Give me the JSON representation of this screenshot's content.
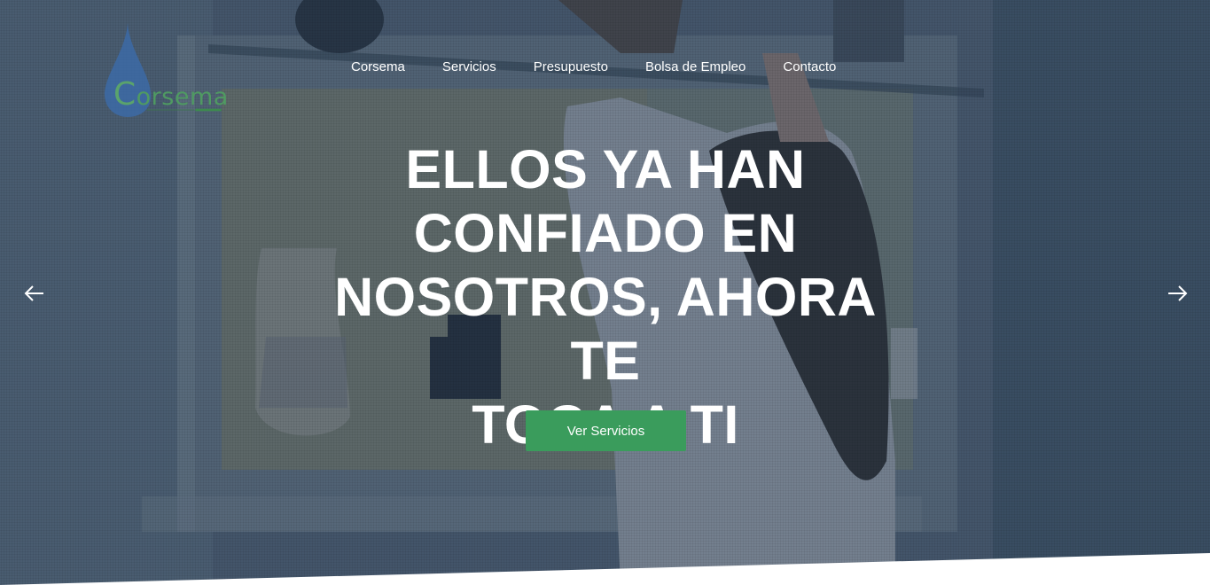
{
  "brand": {
    "name": "Corsema",
    "logo_initial": "C",
    "logo_rest": "orsema",
    "accent_color": "#3a9c5c"
  },
  "nav": {
    "items": [
      {
        "label": "Corsema"
      },
      {
        "label": "Servicios"
      },
      {
        "label": "Presupuesto"
      },
      {
        "label": "Bolsa de Empleo"
      },
      {
        "label": "Contacto"
      }
    ]
  },
  "hero": {
    "headline": "ELLOS YA HAN CONFIADO EN NOSOTROS, AHORA TE TOCA A TI",
    "headline_lines": [
      "ELLOS YA HAN",
      "CONFIADO EN",
      "NOSOTROS, AHORA TE",
      "TOCA A TI"
    ],
    "cta_label": "Ver Servicios"
  },
  "slider": {
    "prev_icon": "arrow-left-icon",
    "next_icon": "arrow-right-icon"
  }
}
